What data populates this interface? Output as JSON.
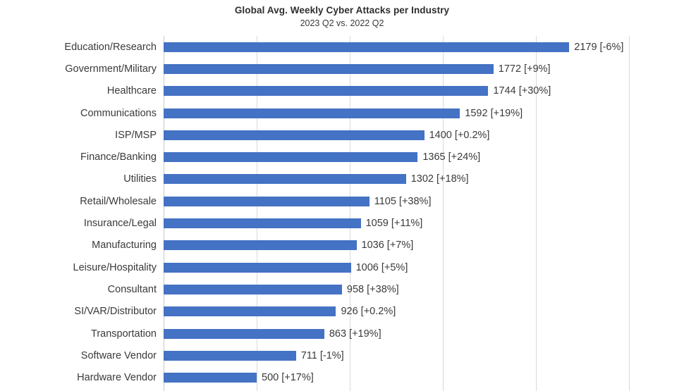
{
  "chart_data": {
    "type": "bar",
    "orientation": "horizontal",
    "title": "Global Avg. Weekly Cyber Attacks per Industry",
    "subtitle": "2023 Q2 vs. 2022 Q2",
    "xlabel": "",
    "ylabel": "",
    "xlim": [
      0,
      2800
    ],
    "grid": true,
    "grid_interval": 500,
    "gridline_values": [
      0,
      500,
      1000,
      1500,
      2000,
      2500
    ],
    "legend": null,
    "bar_color": "#4472c4",
    "gridline_color": "#d9d9d9",
    "categories": [
      "Education/Research",
      "Government/Military",
      "Healthcare",
      "Communications",
      "ISP/MSP",
      "Finance/Banking",
      "Utilities",
      "Retail/Wholesale",
      "Insurance/Legal",
      "Manufacturing",
      "Leisure/Hospitality",
      "Consultant",
      "SI/VAR/Distributor",
      "Transportation",
      "Software Vendor",
      "Hardware Vendor"
    ],
    "values": [
      2179,
      1772,
      1744,
      1592,
      1400,
      1365,
      1302,
      1105,
      1059,
      1036,
      1006,
      958,
      926,
      863,
      711,
      500
    ],
    "change_labels": [
      "-6%",
      "+9%",
      "+30%",
      "+19%",
      "+0.2%",
      "+24%",
      "+18%",
      "+38%",
      "+11%",
      "+7%",
      "+5%",
      "+38%",
      "+0.2%",
      "+19%",
      "-1%",
      "+17%"
    ],
    "data_labels": [
      "2179 [-6%]",
      "1772 [+9%]",
      "1744 [+30%]",
      "1592 [+19%]",
      "1400 [+0.2%]",
      "1365 [+24%]",
      "1302 [+18%]",
      "1105 [+38%]",
      "1059 [+11%]",
      "1036 [+7%]",
      "1006 [+5%]",
      "958 [+38%]",
      "926 [+0.2%]",
      "863 [+19%]",
      "711 [-1%]",
      "500 [+17%]"
    ]
  }
}
